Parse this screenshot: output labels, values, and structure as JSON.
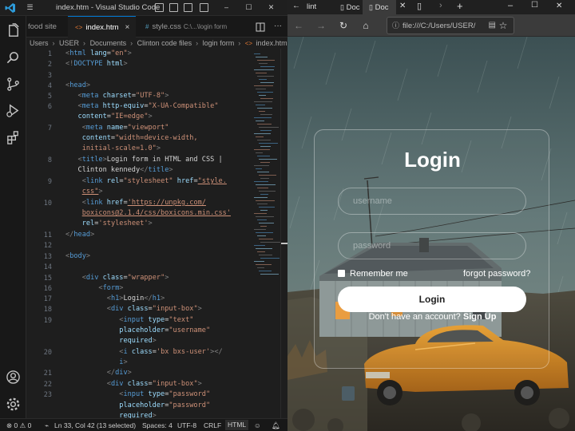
{
  "vscode": {
    "window_title": "index.htm - Visual Studio Code",
    "tabs": [
      {
        "label": "food site",
        "ext": ""
      },
      {
        "label": "index.htm",
        "ext": "<>"
      },
      {
        "label": "style.css",
        "ext": "#",
        "sub": "C:\\...\\login form"
      }
    ],
    "breadcrumbs": [
      "Users",
      "USER",
      "Documents",
      "Clinton code files",
      "login form",
      "index.htm"
    ],
    "line_numbers": [
      "1",
      "2",
      "3",
      "4",
      "5",
      "6",
      "7",
      "8",
      "9",
      "10",
      "11",
      "12",
      "13",
      "14",
      "15",
      "16",
      "17",
      "18",
      "19",
      "20",
      "21",
      "22",
      "23"
    ],
    "status": {
      "errors": "0",
      "warnings": "0",
      "position": "Ln 33, Col 42 (13 selected)",
      "spaces": "Spaces: 4",
      "encoding": "UTF-8",
      "eol": "CRLF",
      "language": "HTML"
    }
  },
  "browser": {
    "tabs": [
      "lint",
      "Doc",
      "Doc"
    ],
    "url": "file:///C:/Users/USER/",
    "login": {
      "title": "Login",
      "username_placeholder": "username",
      "password_placeholder": "password",
      "remember": "Remember me",
      "forgot": "forgot password?",
      "button": "Login",
      "register_text": "Don't have an account?",
      "register_link": "Sign Up"
    }
  },
  "colors": {
    "editor_bg": "#1e1e1e",
    "tag": "#569cd6",
    "attr": "#9cdcfe",
    "string": "#ce9178",
    "accent": "#0078d4"
  }
}
